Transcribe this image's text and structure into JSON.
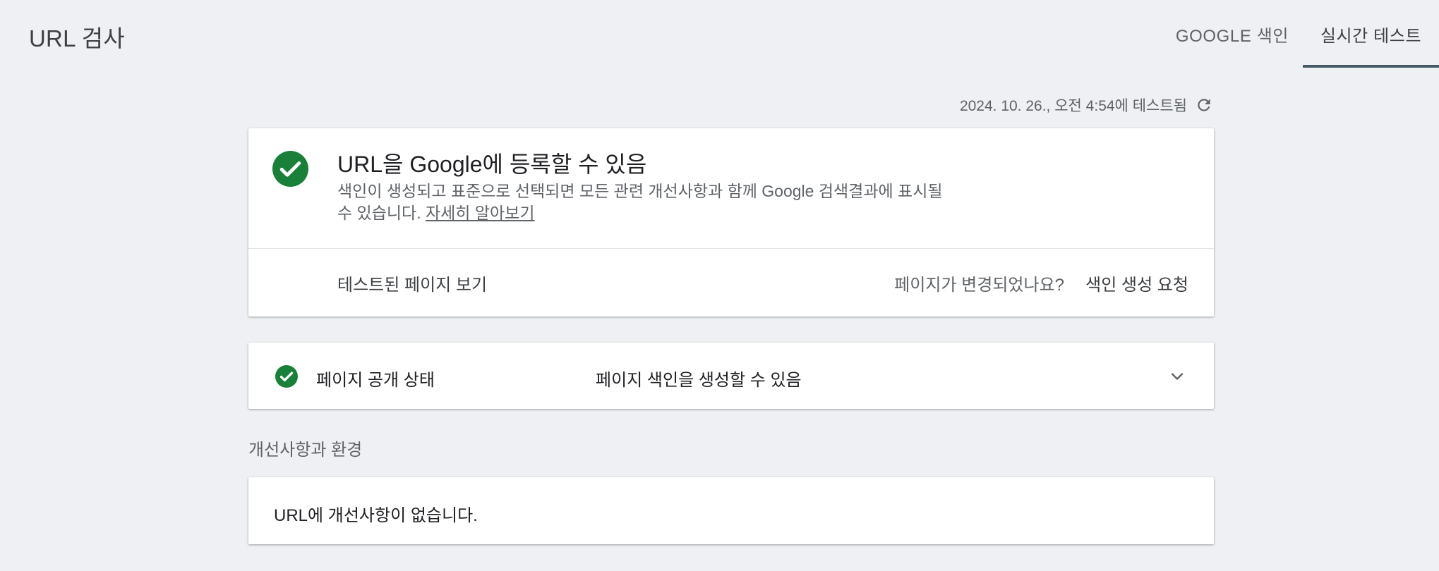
{
  "header": {
    "title": "URL 검사",
    "tabs": [
      {
        "label": "GOOGLE 색인"
      },
      {
        "label": "실시간 테스트"
      }
    ]
  },
  "test_info": {
    "tested_text": "2024. 10. 26., 오전 4:54에 테스트됨"
  },
  "status_card": {
    "title": "URL을 Google에 등록할 수 있음",
    "description": "색인이 생성되고 표준으로 선택되면 모든 관련 개선사항과 함께 Google 검색결과에 표시될 수 있습니다.",
    "learn_more": "자세히 알아보기",
    "view_tested_page": "테스트된 페이지 보기",
    "page_changed_question": "페이지가 변경되었나요?",
    "request_indexing": "색인 생성 요청"
  },
  "availability": {
    "label": "페이지 공개 상태",
    "value": "페이지 색인을 생성할 수 있음"
  },
  "enhancements": {
    "heading": "개선사항과 환경",
    "message": "URL에 개선사항이 없습니다."
  },
  "colors": {
    "success_green": "#188038",
    "active_tab_indicator": "#455a64",
    "background": "#eef0f3"
  }
}
